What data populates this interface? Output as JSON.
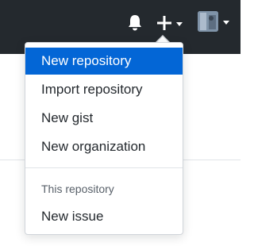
{
  "header": {
    "background": "#24292e",
    "icons": {
      "notifications": "bell-icon",
      "create": "plus-icon",
      "create_caret": "chevron-down-icon",
      "profile_caret": "chevron-down-icon"
    }
  },
  "dropdown": {
    "items": [
      {
        "label": "New repository",
        "active": true
      },
      {
        "label": "Import repository"
      },
      {
        "label": "New gist"
      },
      {
        "label": "New organization"
      }
    ],
    "section_header": "This repository",
    "section_items": [
      {
        "label": "New issue"
      }
    ]
  },
  "colors": {
    "accent": "#0366d6",
    "text": "#24292e",
    "muted": "#586069",
    "border": "#d1d5da"
  }
}
